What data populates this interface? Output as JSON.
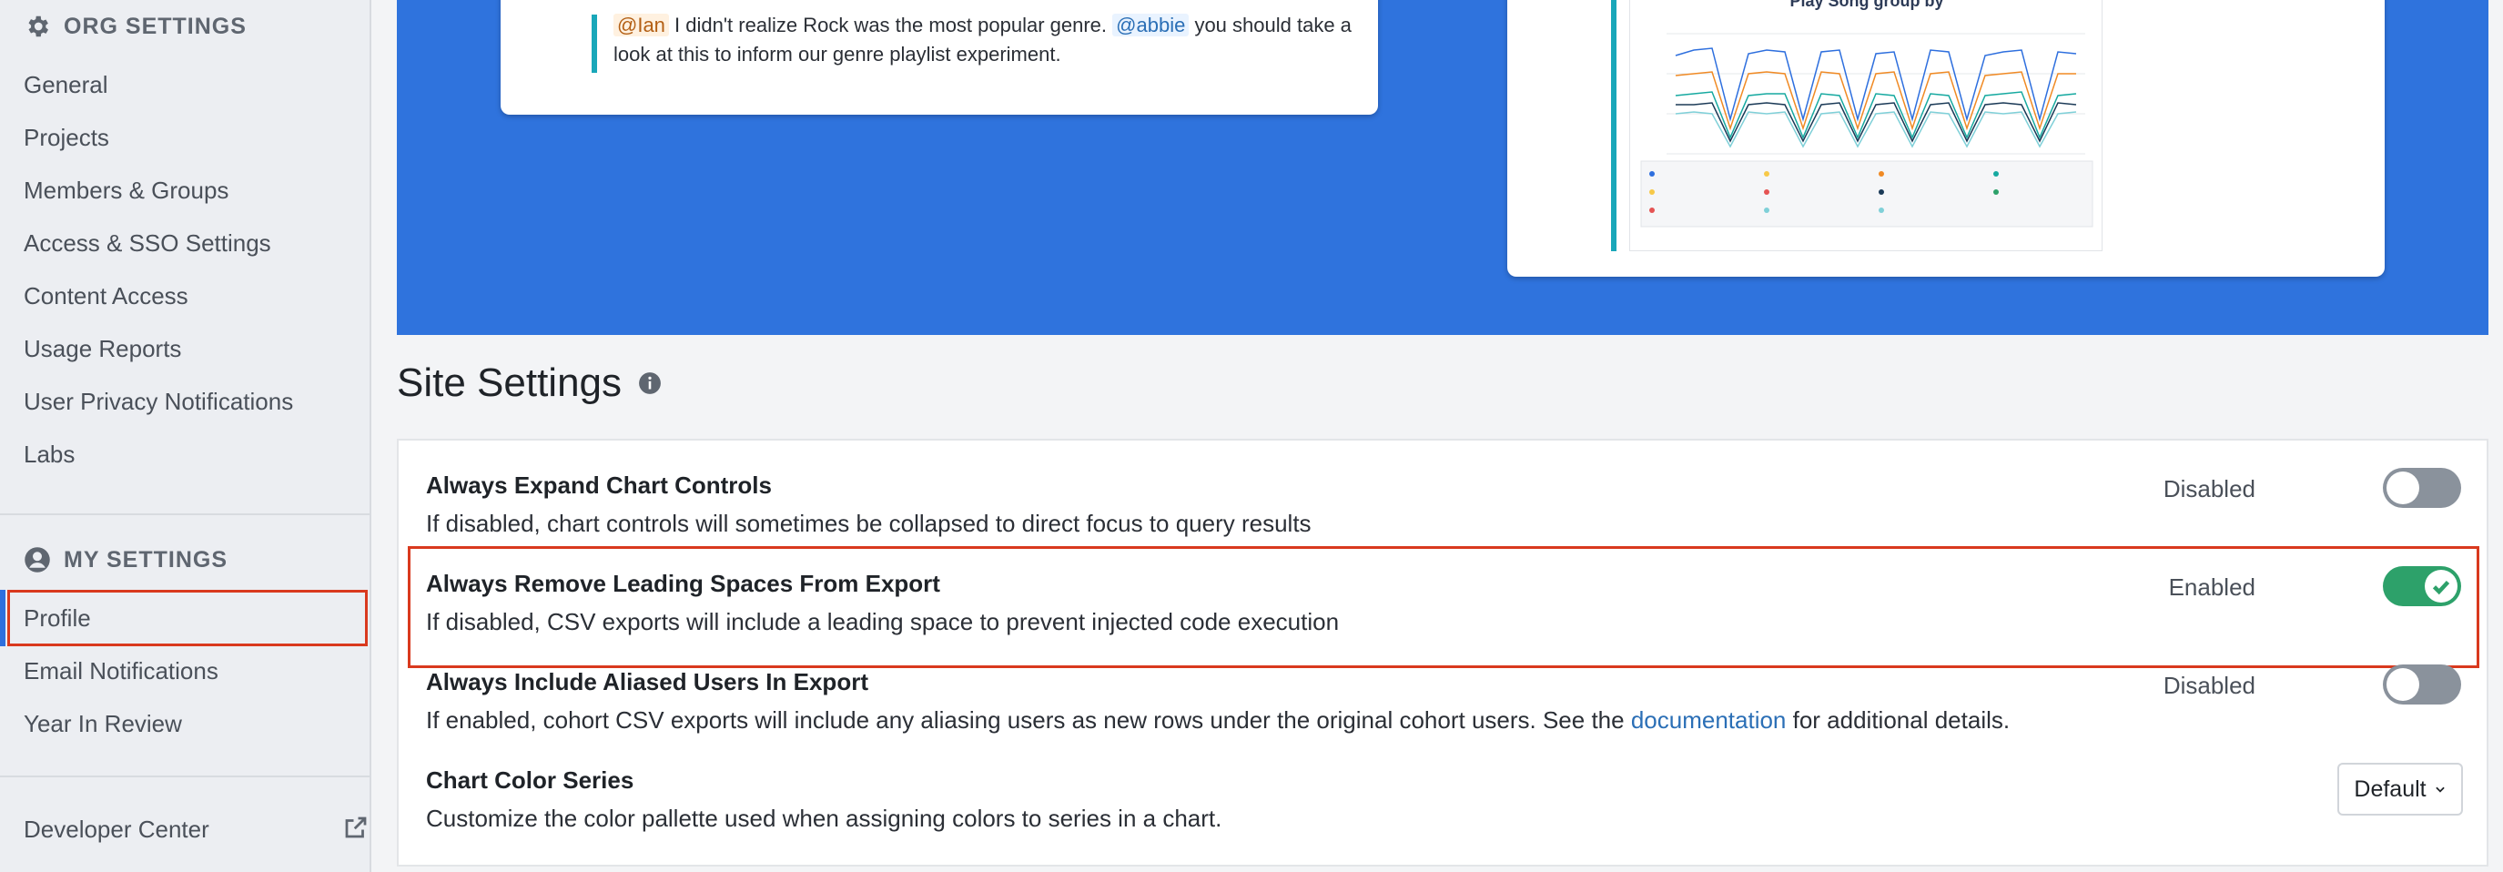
{
  "sidebar": {
    "org_header": "ORG SETTINGS",
    "org_items": [
      {
        "label": "General"
      },
      {
        "label": "Projects"
      },
      {
        "label": "Members & Groups"
      },
      {
        "label": "Access & SSO Settings"
      },
      {
        "label": "Content Access"
      },
      {
        "label": "Usage Reports"
      },
      {
        "label": "User Privacy Notifications"
      },
      {
        "label": "Labs"
      }
    ],
    "my_header": "MY SETTINGS",
    "my_items": [
      {
        "label": "Profile"
      },
      {
        "label": "Email Notifications"
      },
      {
        "label": "Year In Review"
      }
    ],
    "developer_center": "Developer Center"
  },
  "banner": {
    "mention_1": "@Ian",
    "comment_part_1": " I didn't realize Rock was the most popular genre. ",
    "mention_2": "@abbie",
    "comment_part_2": " you should take a look at this to inform our genre playlist experiment.",
    "chart_title": "Play Song group by"
  },
  "site_settings": {
    "title": "Site Settings",
    "rows": [
      {
        "title": "Always Expand Chart Controls",
        "description": "If disabled, chart controls will sometimes be collapsed to direct focus to query results",
        "state_label": "Disabled"
      },
      {
        "title": "Always Remove Leading Spaces From Export",
        "description": "If disabled, CSV exports will include a leading space to prevent injected code execution",
        "state_label": "Enabled"
      },
      {
        "title": "Always Include Aliased Users In Export",
        "description_before": "If enabled, cohort CSV exports will include any aliasing users as new rows under the original cohort users. See the ",
        "link": "documentation",
        "description_after": " for additional details.",
        "state_label": "Disabled"
      },
      {
        "title": "Chart Color Series",
        "description": "Customize the color pallette used when assigning colors to series in a chart.",
        "select_value": "Default"
      }
    ]
  },
  "colors": {
    "accent": "#2f73dd",
    "enabled": "#2da16a",
    "highlight": "#d9391e"
  }
}
